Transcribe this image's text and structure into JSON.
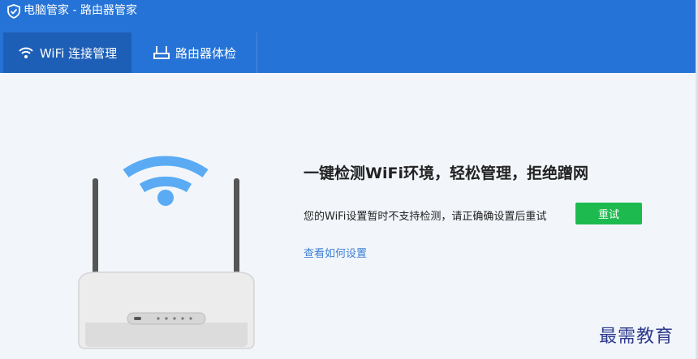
{
  "window": {
    "title": "电脑管家 - 路由器管家",
    "logo_icon": "shield-check-icon"
  },
  "tabs": [
    {
      "label": "WiFi 连接管理",
      "icon": "wifi-icon",
      "active": true
    },
    {
      "label": "路由器体检",
      "icon": "router-icon",
      "active": false
    }
  ],
  "main": {
    "headline": "一键检测WiFi环境，轻松管理，拒绝蹭网",
    "status_text": "您的WiFi设置暂时不支持检测，请正确确设置后重试",
    "retry_label": "重试",
    "help_link": "查看如何设置",
    "illustration": "router-wifi-illustration"
  },
  "watermark": "最需教育",
  "colors": {
    "header": "#2573d6",
    "active_tab": "#1d5fb6",
    "retry_button": "#1dbb4f",
    "link": "#3d7fd6",
    "background": "#f2f6fb"
  }
}
